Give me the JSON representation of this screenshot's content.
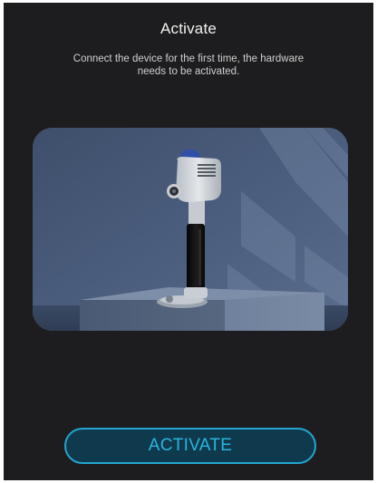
{
  "header": {
    "title": "Activate",
    "subtitle": "Connect the device for the first time, the hardware needs to be activated."
  },
  "illustration": {
    "subject": "handheld scanner device on pedestal",
    "colors": {
      "wall": "#4a5c78",
      "pedestal": "#5f7089",
      "device_body": "#d4d8dd",
      "device_handle": "#111111",
      "indicator": "#2f4fa8"
    }
  },
  "footer": {
    "activate_label": "ACTIVATE"
  },
  "colors": {
    "background": "#1d1d1f",
    "accent": "#2ab5df",
    "button_fill": "#0f3a4d"
  }
}
